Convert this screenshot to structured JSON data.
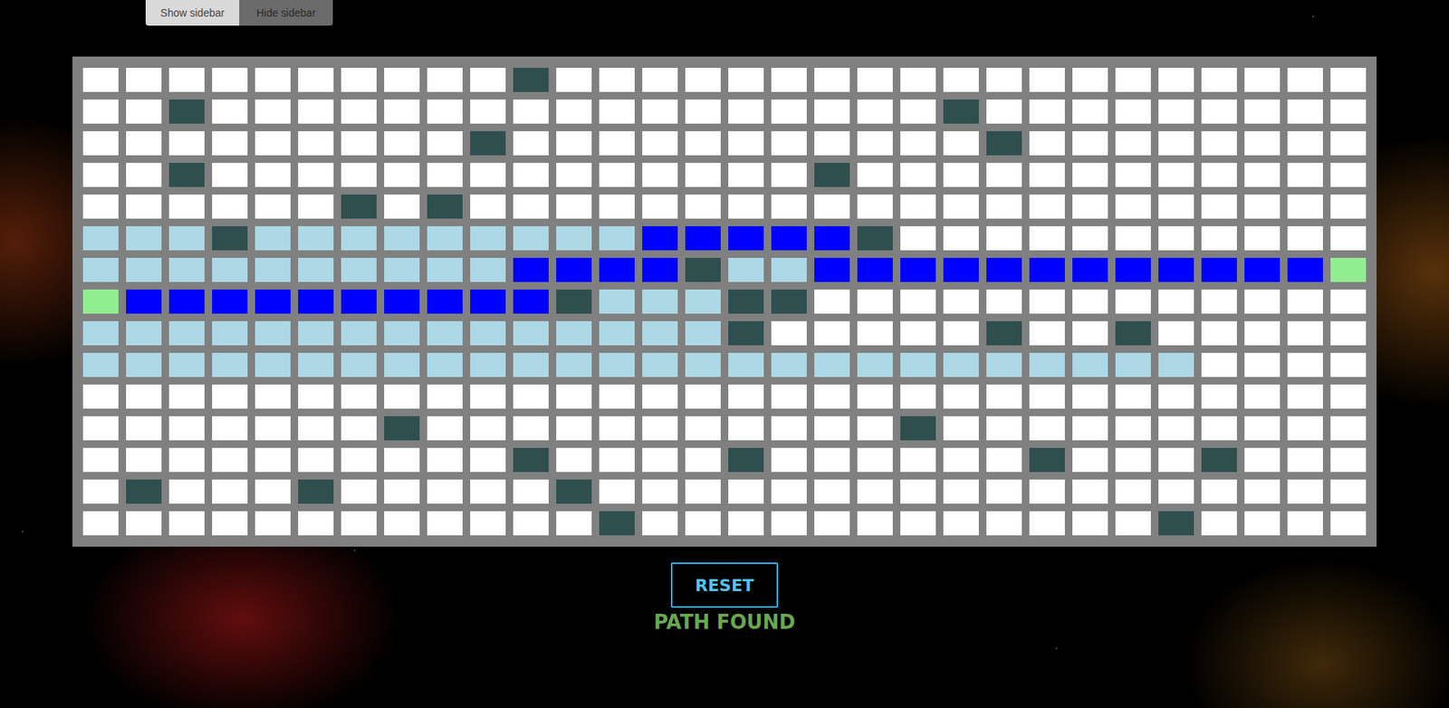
{
  "sidebar_buttons": [
    {
      "label": "Show sidebar",
      "selected": false
    },
    {
      "label": "Hide sidebar",
      "selected": true
    }
  ],
  "grid": {
    "legend": {
      ".": "empty",
      "#": "wall",
      "v": "visited",
      "p": "path",
      "s": "start",
      "t": "target"
    },
    "rows": [
      "..........#...................",
      "..#.................#.........",
      ".........#...........#........",
      "..#..............#............",
      "......#.#.....................",
      "vvv#vvvvvvvvvppppp#...........",
      "vvvvvvvvvvpppp#vvppppppppppppt",
      "spppppppppp#vvv##.............",
      "vvvvvvvvvvvvvvv#.....#..#.....",
      "vvvvvvvvvvvvvvvvvvvvvvvvvv....",
      "..............................",
      ".......#...........#..........",
      "..........#....#......#...#...",
      ".#...#.....#..................",
      "............#............#...."
    ]
  },
  "reset_button": {
    "label": "RESET"
  },
  "status": "PATH FOUND"
}
